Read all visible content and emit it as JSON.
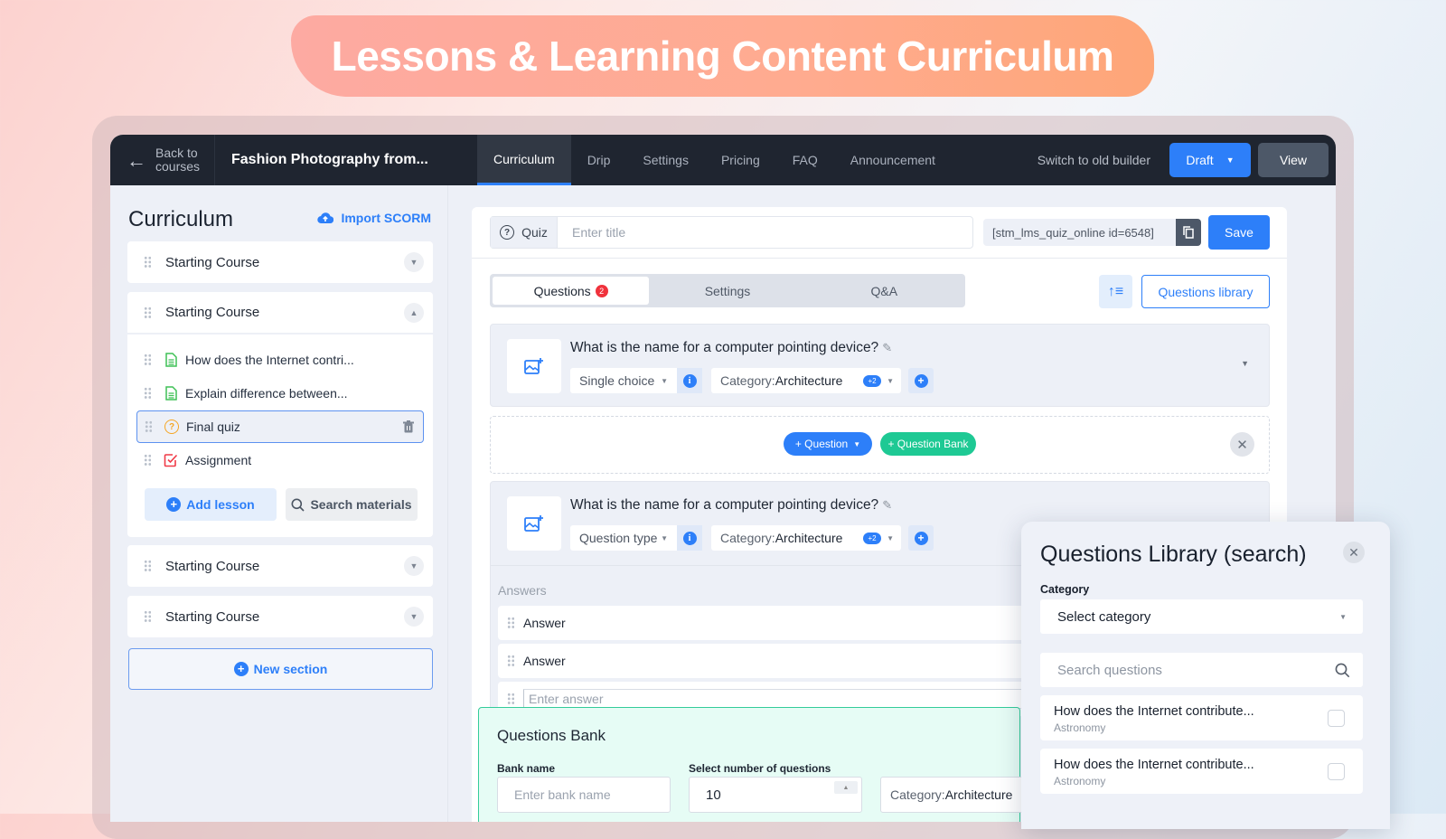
{
  "banner": {
    "title": "Lessons & Learning Content Curriculum"
  },
  "topbar": {
    "back_label_line1": "Back to",
    "back_label_line2": "courses",
    "course_title": "Fashion Photography from...",
    "tabs": [
      {
        "label": "Curriculum",
        "active": true
      },
      {
        "label": "Drip"
      },
      {
        "label": "Settings"
      },
      {
        "label": "Pricing"
      },
      {
        "label": "FAQ"
      },
      {
        "label": "Announcement"
      }
    ],
    "switch_label": "Switch to old builder",
    "draft_label": "Draft",
    "view_label": "View"
  },
  "sidebar": {
    "title": "Curriculum",
    "import_label": "Import SCORM",
    "sections": [
      {
        "label": "Starting Course",
        "expanded": false
      },
      {
        "label": "Starting Course",
        "expanded": true
      },
      {
        "label": "Starting Course",
        "expanded": false
      },
      {
        "label": "Starting Course",
        "expanded": false
      }
    ],
    "lessons": [
      {
        "label": "How does the Internet contri...",
        "type": "text-lesson"
      },
      {
        "label": "Explain difference between...",
        "type": "text-lesson"
      },
      {
        "label": "Final quiz",
        "type": "quiz",
        "selected": true
      },
      {
        "label": "Assignment",
        "type": "assignment"
      }
    ],
    "add_lesson_label": "Add lesson",
    "search_materials_label": "Search materials",
    "new_section_label": "New section"
  },
  "editor": {
    "quiz_tag": "Quiz",
    "title_placeholder": "Enter title",
    "shortcode": "[stm_lms_quiz_online id=6548]",
    "save_label": "Save",
    "tabs": [
      {
        "label": "Questions",
        "badge": "2",
        "active": true
      },
      {
        "label": "Settings"
      },
      {
        "label": "Q&A"
      }
    ],
    "questions_library_label": "Questions library",
    "questions": [
      {
        "text": "What is the name for a computer pointing device?",
        "type": "Single choice",
        "category_prefix": "Category:",
        "category": "Architecture",
        "extra_count": "+2"
      },
      {
        "text": "What is the name for a computer pointing device?",
        "type": "Question type",
        "category_prefix": "Category:",
        "category": "Architecture",
        "extra_count": "+2"
      }
    ],
    "add_question_label": "+ Question",
    "add_bank_label": "+ Question Bank",
    "answers_label": "Answers",
    "answers": [
      "Answer",
      "Answer"
    ],
    "answer_placeholder": "Enter answer",
    "bank": {
      "title": "Questions Bank",
      "name_label": "Bank name",
      "name_placeholder": "Enter bank name",
      "count_label": "Select number of questions",
      "count_value": "10",
      "category_prefix": "Category:",
      "category": "Architecture"
    }
  },
  "library": {
    "title": "Questions Library (search)",
    "category_label": "Category",
    "category_placeholder": "Select category",
    "search_placeholder": "Search questions",
    "items": [
      {
        "title": "How does the Internet contribute...",
        "category": "Astronomy",
        "checked": false
      },
      {
        "title": "How does the Internet contribute...",
        "category": "Astronomy",
        "checked": false
      }
    ]
  },
  "colors": {
    "accent": "#2d7ff9",
    "green": "#1ec994",
    "topbar": "#1f2530",
    "danger": "#f0323c",
    "quiz": "#f5a623"
  }
}
